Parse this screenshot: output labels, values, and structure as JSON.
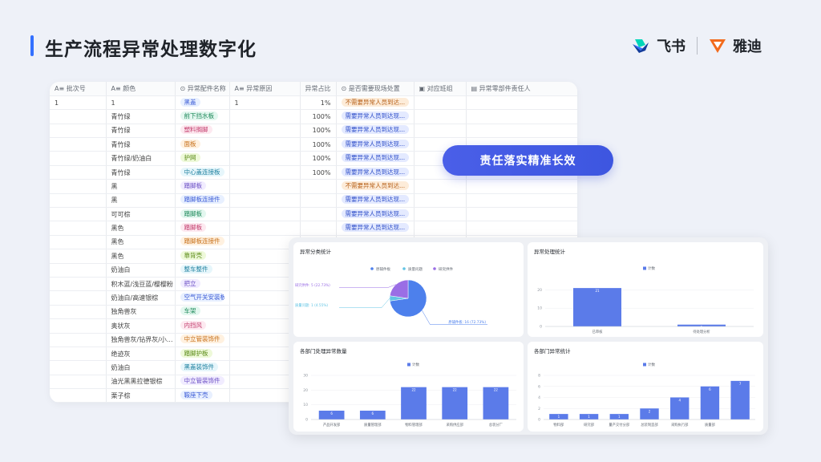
{
  "page": {
    "title": "生产流程异常处理数字化"
  },
  "brands": [
    {
      "name": "飞书",
      "logo": "feishu-logo"
    },
    {
      "name": "雅迪",
      "logo": "yadea-logo"
    }
  ],
  "table": {
    "columns": [
      "A≡ 批次号",
      "A≡ 颜色",
      "⊙ 异常配件名称",
      "A≡ 异常原因",
      "异常占比",
      "⊙ 是否需要现场处置",
      "▣ 对应班组",
      "▤ 异常零部件责任人"
    ],
    "rows": [
      {
        "batch": "1",
        "color": "1",
        "part": "黑盖",
        "reason": "1",
        "ratio": "1%",
        "onsite": "不需要异常人员到达..."
      },
      {
        "batch": "",
        "color": "青竹绿",
        "part": "前下挡水板",
        "reason": "",
        "ratio": "100%",
        "onsite": "需要异常人员到达现..."
      },
      {
        "batch": "",
        "color": "青竹绿",
        "part": "塑料搁脚",
        "reason": "",
        "ratio": "100%",
        "onsite": "需要异常人员到达现..."
      },
      {
        "batch": "",
        "color": "青竹绿",
        "part": "面板",
        "reason": "",
        "ratio": "100%",
        "onsite": "需要异常人员到达现..."
      },
      {
        "batch": "",
        "color": "青竹绿/奶油白",
        "part": "护网",
        "reason": "",
        "ratio": "100%",
        "onsite": "需要异常人员到达现..."
      },
      {
        "batch": "",
        "color": "青竹绿",
        "part": "中心盖连接板",
        "reason": "",
        "ratio": "100%",
        "onsite": "需要异常人员到达现..."
      },
      {
        "batch": "",
        "color": "黑",
        "part": "踏脚板",
        "reason": "",
        "ratio": "",
        "onsite": "不需要异常人员到达..."
      },
      {
        "batch": "",
        "color": "黑",
        "part": "踏脚板连接件",
        "reason": "",
        "ratio": "",
        "onsite": "需要异常人员到达现..."
      },
      {
        "batch": "",
        "color": "可可棕",
        "part": "踏脚板",
        "reason": "",
        "ratio": "",
        "onsite": "需要异常人员到达现..."
      },
      {
        "batch": "",
        "color": "黑色",
        "part": "踏脚板",
        "reason": "",
        "ratio": "",
        "onsite": "需要异常人员到达现..."
      },
      {
        "batch": "",
        "color": "黑色",
        "part": "踏脚板连接件",
        "reason": "",
        "ratio": "",
        "onsite": ""
      },
      {
        "batch": "",
        "color": "黑色",
        "part": "靠背壳",
        "reason": "",
        "ratio": "",
        "onsite": ""
      },
      {
        "batch": "",
        "color": "奶油白",
        "part": "整车整件",
        "reason": "",
        "ratio": "",
        "onsite": ""
      },
      {
        "batch": "",
        "color": "积木蓝/浅豆蓝/樱樱粉",
        "part": "把立",
        "reason": "",
        "ratio": "",
        "onsite": ""
      },
      {
        "batch": "",
        "color": "奶油白/高速银棕",
        "part": "空气开关安装板",
        "reason": "",
        "ratio": "",
        "onsite": ""
      },
      {
        "batch": "",
        "color": "独角兽灰",
        "part": "车架",
        "reason": "",
        "ratio": "",
        "onsite": ""
      },
      {
        "batch": "",
        "color": "奥状灰",
        "part": "内挡风",
        "reason": "",
        "ratio": "",
        "onsite": ""
      },
      {
        "batch": "",
        "color": "独角兽灰/钻界灰/小...",
        "part": "中立管装饰件",
        "reason": "",
        "ratio": "",
        "onsite": ""
      },
      {
        "batch": "",
        "color": "绝迹灰",
        "part": "踏脚护板",
        "reason": "",
        "ratio": "",
        "onsite": ""
      },
      {
        "batch": "",
        "color": "奶油白",
        "part": "黑盖装饰件",
        "reason": "",
        "ratio": "",
        "onsite": ""
      },
      {
        "batch": "",
        "color": "油光黑黑拉德银棕",
        "part": "中立管装饰件",
        "reason": "",
        "ratio": "",
        "onsite": ""
      },
      {
        "batch": "",
        "color": "栗子棕",
        "part": "鞍座下壳",
        "reason": "",
        "ratio": "",
        "onsite": ""
      }
    ]
  },
  "cta": {
    "label": "责任落实精准长效"
  },
  "colors": {
    "accent": "#3370ff",
    "bar": "#5b7be9",
    "cta": "#3d56e0"
  },
  "dashboard": {
    "pie_card": {
      "title": "异常分类统计",
      "chart_data": {
        "type": "pie",
        "legend": [
          "原辅件板",
          "质量问题",
          "研究供件"
        ],
        "slices": [
          {
            "label": "原辅件板: 16 (72.73%)",
            "value": 16,
            "color": "#4d80ec"
          },
          {
            "label": "质量问题: 1 (4.55%)",
            "value": 1,
            "color": "#62c4e4"
          },
          {
            "label": "研究供件: 5 (22.73%)",
            "value": 5,
            "color": "#9a6ee5"
          }
        ]
      }
    },
    "bar_card_1": {
      "title": "异常处理统计",
      "chart_data": {
        "type": "bar",
        "legend": "计数",
        "categories": [
          "已审核",
          "待处理分析"
        ],
        "values": [
          21,
          1
        ],
        "yticks": [
          "0",
          "10",
          "20"
        ],
        "ylim": [
          0,
          25
        ]
      }
    },
    "bar_card_2": {
      "title": "各部门处理异常数量",
      "chart_data": {
        "type": "bar",
        "legend": "计数",
        "categories": [
          "产品开发部",
          "质量管理部",
          "物料管理部",
          "采购供应部",
          "总装分厂"
        ],
        "values": [
          6,
          6,
          22,
          22,
          22
        ],
        "yticks": [
          "0",
          "10",
          "20",
          "30"
        ],
        "ylim": [
          0,
          30
        ]
      }
    },
    "bar_card_3": {
      "title": "各部门异常统计",
      "chart_data": {
        "type": "bar",
        "legend": "计数",
        "categories": [
          "物料部",
          "研究部",
          "量产交付分部",
          "总装制造部",
          "采购执行部",
          "质量部"
        ],
        "values": [
          1,
          1,
          1,
          2,
          4,
          6,
          7
        ],
        "yticks": [
          "0",
          "2",
          "4",
          "6",
          "8"
        ],
        "ylim": [
          0,
          8
        ]
      }
    }
  }
}
